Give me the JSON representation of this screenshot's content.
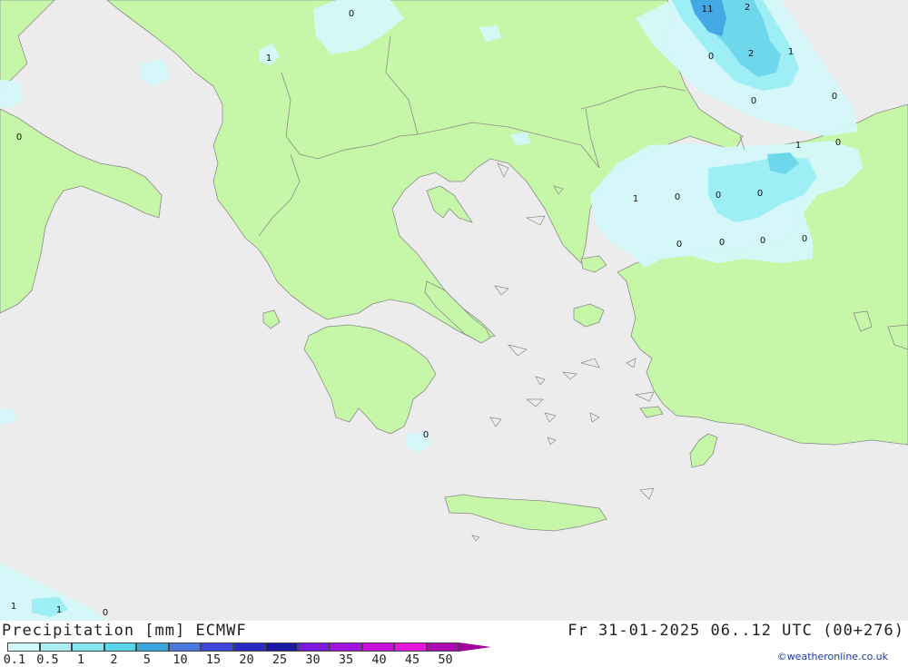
{
  "map": {
    "colors": {
      "sea": "#ececec",
      "land": "#c6f7a8",
      "border": "#8a8a8a",
      "precip_light": "#d4f8fa",
      "precip_mid": "#9eeef5",
      "precip_high": "#6fd7ec",
      "precip_max": "#43a8e4"
    },
    "value_labels": [
      {
        "text": "0"
      },
      {
        "text": "1"
      },
      {
        "text": "11"
      },
      {
        "text": "2"
      },
      {
        "text": "0"
      },
      {
        "text": "2"
      },
      {
        "text": "1"
      },
      {
        "text": "0"
      },
      {
        "text": "0"
      },
      {
        "text": "1"
      },
      {
        "text": "0"
      },
      {
        "text": "1"
      },
      {
        "text": "0"
      },
      {
        "text": "0"
      },
      {
        "text": "0"
      },
      {
        "text": "0"
      },
      {
        "text": "0"
      },
      {
        "text": "0"
      },
      {
        "text": "0"
      },
      {
        "text": "0"
      },
      {
        "text": "0"
      },
      {
        "text": "1"
      },
      {
        "text": "1"
      },
      {
        "text": "0"
      }
    ]
  },
  "footer": {
    "title": "Precipitation [mm] ECMWF",
    "valid_time": "Fr 31-01-2025 06..12 UTC (00+276)",
    "credit": "©weatheronline.co.uk"
  },
  "legend": {
    "ticks": [
      "0.1",
      "0.5",
      "1",
      "2",
      "5",
      "10",
      "15",
      "20",
      "25",
      "30",
      "35",
      "40",
      "45",
      "50"
    ],
    "colors": [
      "#d2fafa",
      "#aaf0f0",
      "#82e6ec",
      "#5ad4e8",
      "#3aa6dc",
      "#4a78dc",
      "#3c46d8",
      "#2a2ac0",
      "#1a1aa0",
      "#7818e0",
      "#a014e0",
      "#c810dc",
      "#e614dc",
      "#b00ab4"
    ]
  }
}
